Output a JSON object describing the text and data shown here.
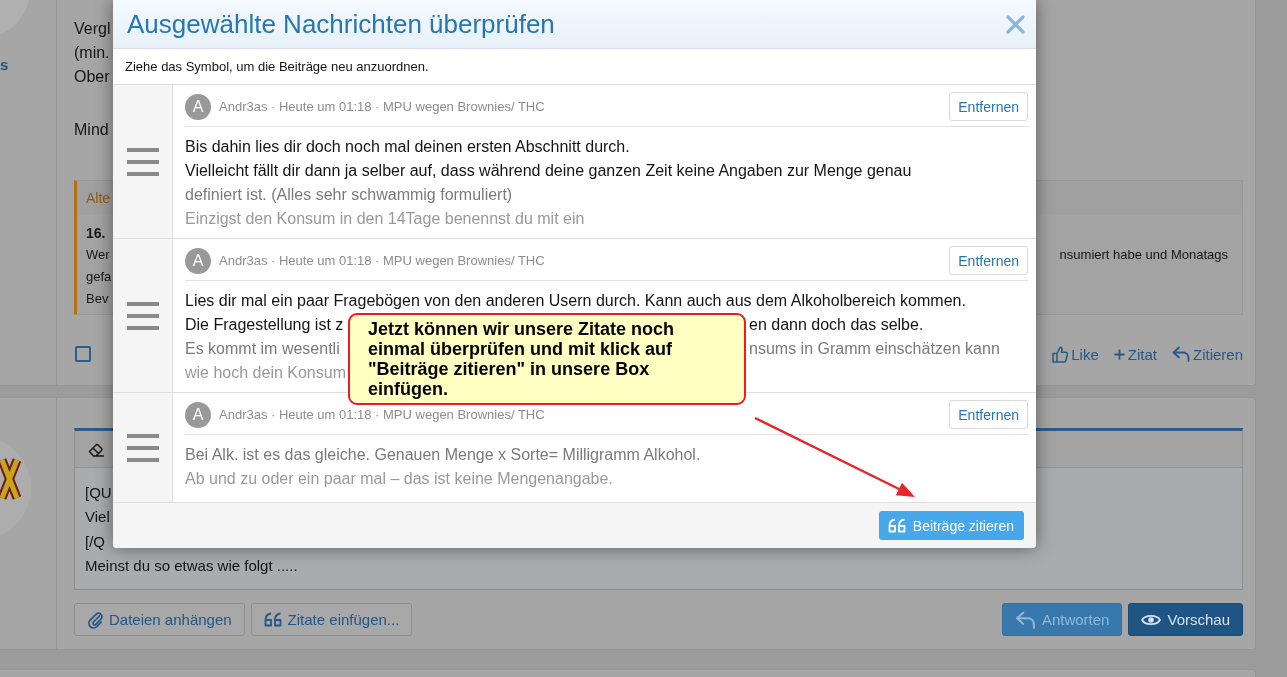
{
  "background": {
    "post": {
      "author_fragment": "s",
      "paragraphs": [
        [
          "Vergl",
          "(min.",
          "Ober"
        ],
        [
          "Mind"
        ]
      ],
      "quote": {
        "title": "Alte",
        "heading": "16.",
        "lines": [
          {
            "start": "Wer",
            "end": "nsumiert habe und Monatags"
          },
          {
            "start": "gefa"
          },
          {
            "start": "Bev"
          }
        ]
      },
      "checked": false,
      "actions": [
        {
          "kind": "like",
          "label": "Like"
        },
        {
          "kind": "add",
          "label": "Zitat"
        },
        {
          "kind": "reply",
          "label": "Zitieren"
        }
      ]
    },
    "reply_editor": {
      "lines": [
        "[QU",
        "Viel",
        "[/Q",
        "Meinst du so etwas wie folgt ....."
      ],
      "tools": [
        {
          "kind": "attach",
          "label": "Dateien anhängen"
        },
        {
          "kind": "quote",
          "label": "Zitate einfügen..."
        }
      ],
      "submit": [
        {
          "kind": "reply",
          "label": "Antworten"
        },
        {
          "kind": "preview",
          "label": "Vorschau"
        }
      ]
    }
  },
  "dialog": {
    "title": "Ausgewählte Nachrichten überprüfen",
    "hint": "Ziehe das Symbol, um die Beiträge neu anzuordnen.",
    "messages": [
      {
        "avatar_letter": "A",
        "meta": "Andr3as · Heute um 01:18 · MPU wegen Brownies/ THC",
        "remove_label": "Entfernen",
        "lines": [
          {
            "segments": [
              "Bis dahin lies dir doch noch mal deinen ersten Abschnitt durch."
            ]
          },
          {
            "segments": [
              "Vielleicht fällt dir dann ja selber auf, dass während deine ganzen Zeit keine Angaben zur Menge genau"
            ]
          },
          {
            "segments": [
              "definiert ist. (Alles sehr schwammig formuliert)"
            ]
          },
          {
            "segments": [
              "Einzigst den Konsum in den 14Tage benennst du mit ein"
            ]
          }
        ]
      },
      {
        "avatar_letter": "A",
        "meta": "Andr3as · Heute um 01:18 · MPU wegen Brownies/ THC",
        "remove_label": "Entfernen",
        "lines": [
          {
            "segments": [
              "Lies dir mal ein paar Fragebögen von den anderen Usern durch. Kann auch aus dem Alkoholbereich kommen."
            ]
          },
          {
            "segments": [
              "Die Fragestellung ist z",
              "en dann doch das selbe."
            ]
          },
          {
            "segments": [
              "Es kommt im wesentli",
              "nsums in Gramm einschätzen kann"
            ]
          },
          {
            "segments": [
              "wie hoch dein Konsum"
            ]
          }
        ]
      },
      {
        "avatar_letter": "A",
        "meta": "Andr3as · Heute um 01:18 · MPU wegen Brownies/ THC",
        "remove_label": "Entfernen",
        "lines": [
          {
            "segments": [
              "Bei Alk. ist es das gleiche. Genauen Menge x Sorte= Milligramm Alkohol."
            ]
          },
          {
            "segments": [
              "Ab und zu oder ein paar mal – das ist keine Mengenangabe."
            ]
          }
        ]
      }
    ],
    "confirm_label": "Beiträge zitieren"
  },
  "callout": {
    "text": "Jetzt können wir unsere Zitate noch einmal überprüfen und mit klick auf \"Beiträge zitieren\" in unsere Box einfügen."
  }
}
